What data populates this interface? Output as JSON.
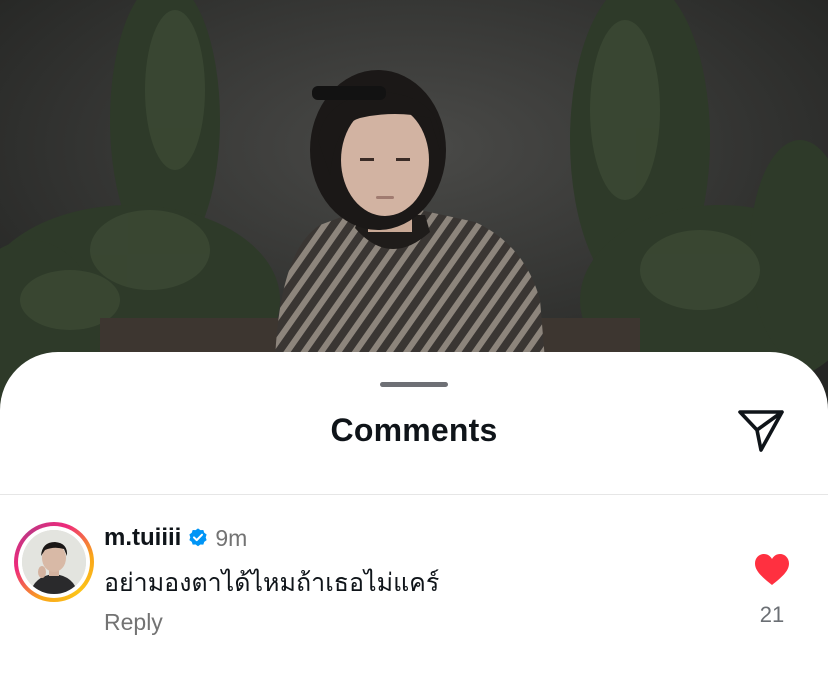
{
  "sheet": {
    "title": "Comments",
    "share_icon": "paper-plane-icon"
  },
  "comment": {
    "username": "m.tuiiii",
    "verified_icon": "verified-badge-icon",
    "time": "9m",
    "text": "อย่ามองตาได้ไหมถ้าเธอไม่แคร์",
    "reply_label": "Reply",
    "like_icon": "heart-filled-icon",
    "like_count": "21",
    "liked": true
  },
  "colors": {
    "like_red": "#ff3040",
    "verified_blue": "#0095f6",
    "secondary_text": "#737373",
    "primary_text": "#0f1419"
  }
}
